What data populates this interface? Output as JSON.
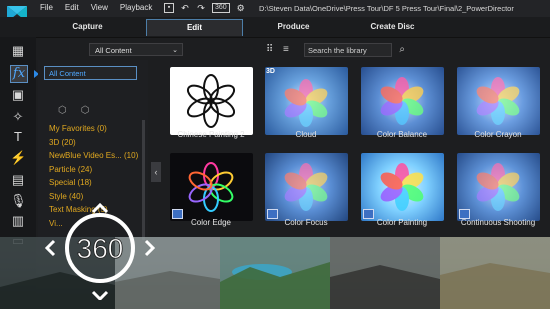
{
  "menu": {
    "items": [
      "File",
      "Edit",
      "View",
      "Playback"
    ]
  },
  "toolbar": {
    "zoom_label": "360"
  },
  "project_path": "D:\\Steven Data\\OneDrive\\Press Tour\\DF 5 Press Tour\\Final\\2_PowerDirector",
  "modes": [
    "Capture",
    "Edit",
    "Produce",
    "Create Disc"
  ],
  "active_mode": "Edit",
  "filter": {
    "selected": "All Content"
  },
  "search": {
    "placeholder": "Search the library"
  },
  "categories": {
    "active": "All Content",
    "items": [
      "My Favorites  (0)",
      "3D  (20)",
      "NewBlue Video Es...  (10)",
      "Particle  (24)",
      "Special  (18)",
      "Style  (40)",
      "Text Masking  (5)",
      "Vi..."
    ]
  },
  "effects": [
    {
      "name": "Chinese Painting 2",
      "is3d": false
    },
    {
      "name": "Cloud",
      "is3d": true
    },
    {
      "name": "Color Balance",
      "is3d": false
    },
    {
      "name": "Color Crayon",
      "is3d": false
    },
    {
      "name": "Color Edge",
      "is3d": false
    },
    {
      "name": "Color Focus",
      "is3d": false
    },
    {
      "name": "Color Painting",
      "is3d": false
    },
    {
      "name": "Continuous Shooting",
      "is3d": false
    }
  ],
  "overlay": {
    "badge_text": "360"
  },
  "colors": {
    "accent": "#2c8ae8",
    "category_text": "#e0a820",
    "brand": "#1fa9d6"
  }
}
